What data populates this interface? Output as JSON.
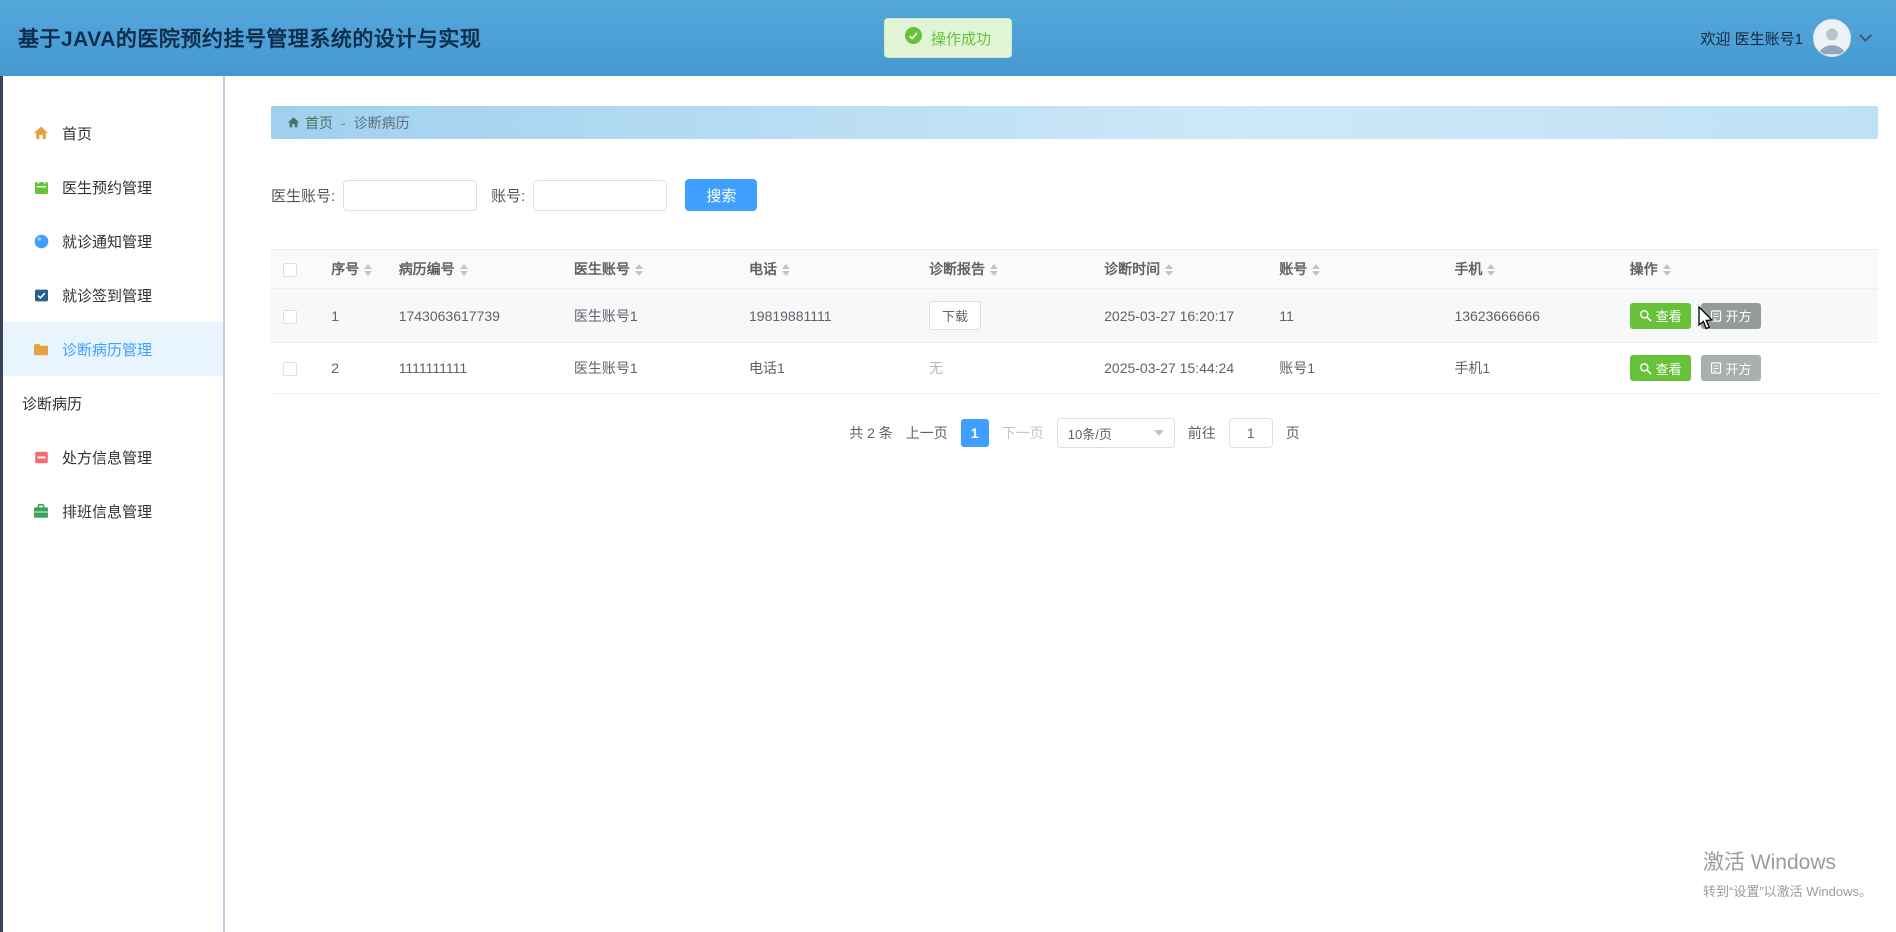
{
  "colors": {
    "accent": "#409eff",
    "success": "#67c23a",
    "info_gray": "#949b9b",
    "header_bg": "#4aa0d8"
  },
  "header": {
    "title": "基于JAVA的医院预约挂号管理系统的设计与实现",
    "toast": {
      "text": "操作成功"
    },
    "welcome": "欢迎 医生账号1"
  },
  "sidebar": {
    "items": [
      {
        "label": "首页",
        "icon": "home-icon",
        "icon_color": "#e6a23c"
      },
      {
        "label": "医生预约管理",
        "icon": "appointment-icon",
        "icon_color": "#67c23a"
      },
      {
        "label": "就诊通知管理",
        "icon": "notice-icon",
        "icon_color": "#409eff"
      },
      {
        "label": "就诊签到管理",
        "icon": "checkin-icon",
        "icon_color": "#2d5f8b"
      },
      {
        "label": "诊断病历管理",
        "icon": "records-icon",
        "icon_color": "#e6a23c",
        "active": true
      },
      {
        "label": "诊断病历",
        "type": "submenu"
      },
      {
        "label": "处方信息管理",
        "icon": "prescription-icon",
        "icon_color": "#f56c6c"
      },
      {
        "label": "排班信息管理",
        "icon": "schedule-icon",
        "icon_color": "#3da35a"
      }
    ]
  },
  "breadcrumb": {
    "home": "首页",
    "separator": "-",
    "current": "诊断病历"
  },
  "search": {
    "doctor_label": "医生账号:",
    "account_label": "账号:",
    "button": "搜索"
  },
  "table": {
    "columns": [
      "序号",
      "病历编号",
      "医生账号",
      "电话",
      "诊断报告",
      "诊断时间",
      "账号",
      "手机",
      "操作"
    ],
    "actions": {
      "view": "查看",
      "prescribe": "开方"
    },
    "rows": [
      {
        "index": "1",
        "record_no": "1743063617739",
        "doctor_account": "医生账号1",
        "phone": "19819881111",
        "report": "下载",
        "time": "2025-03-27 16:20:17",
        "account": "11",
        "mobile": "13623666666"
      },
      {
        "index": "2",
        "record_no": "1111111111",
        "doctor_account": "医生账号1",
        "phone": "电话1",
        "report": "无",
        "time": "2025-03-27 15:44:24",
        "account": "账号1",
        "mobile": "手机1"
      }
    ]
  },
  "pagination": {
    "total": "共 2 条",
    "prev": "上一页",
    "page": "1",
    "next": "下一页",
    "page_size": "10条/页",
    "goto_prefix": "前往",
    "goto_value": "1",
    "goto_suffix": "页"
  },
  "watermark": {
    "line1": "激活 Windows",
    "line2": "转到“设置”以激活 Windows。"
  }
}
